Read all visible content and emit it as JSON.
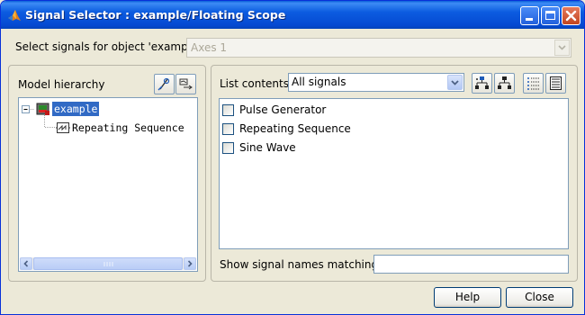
{
  "window": {
    "title": "Signal Selector : example/Floating Scope",
    "accent_color": "#0054e3",
    "selection_color": "#316ac5"
  },
  "select_signals": {
    "label": "Select signals for object 'example'",
    "axes_value": "Axes 1"
  },
  "left_panel": {
    "label": "Model hierarchy",
    "tree": [
      {
        "label": "example",
        "selected": true,
        "icon": "simulink-model-icon"
      },
      {
        "label": "Repeating Sequence",
        "selected": false,
        "icon": "subsystem-icon"
      }
    ]
  },
  "right_panel": {
    "list_contents_label": "List contents:",
    "list_contents_value": "All signals",
    "signals": [
      {
        "label": "Pulse Generator",
        "checked": false
      },
      {
        "label": "Repeating Sequence",
        "checked": false
      },
      {
        "label": "Sine Wave",
        "checked": false
      }
    ],
    "filter_label": "Show signal names matching:",
    "filter_value": ""
  },
  "buttons": {
    "help": "Help",
    "close": "Close"
  }
}
